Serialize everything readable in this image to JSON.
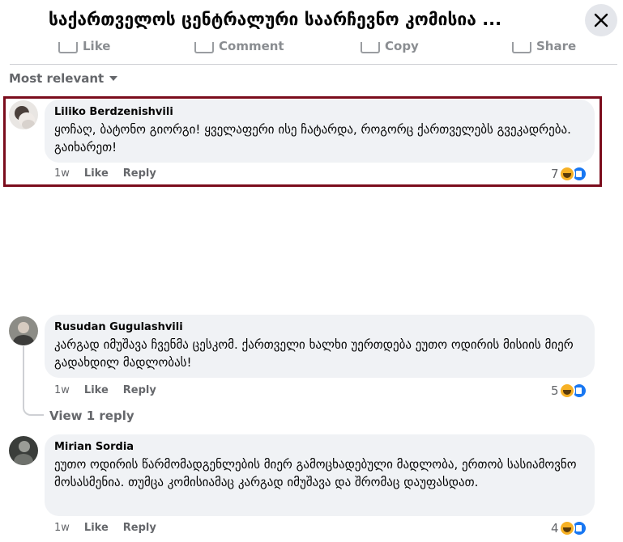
{
  "header": {
    "title": "საქართველოს ცენტრალური საარჩევნო კომისია ...",
    "close_icon": "close-icon"
  },
  "action_bar": [
    {
      "label": "Like",
      "icon": "thumbs-up-icon"
    },
    {
      "label": "Comment",
      "icon": "comment-icon"
    },
    {
      "label": "Copy",
      "icon": "copy-icon"
    },
    {
      "label": "Share",
      "icon": "share-icon"
    }
  ],
  "sort": {
    "label": "Most relevant",
    "icon": "caret-down-icon"
  },
  "comments": [
    {
      "author": "Liliko Berdzenishvili",
      "text": "ყოჩაღ, ბატონო გიორგი! ყველაფერი ისე ჩატარდა, როგორც ქართველებს გვეკადრება. გაიხარეთ!",
      "time": "1w",
      "like": "Like",
      "reply": "Reply",
      "reactions": "7"
    },
    {
      "author": "Rusudan Gugulashvili",
      "text": "კარგად იმუშავა ჩვენმა ცესკომ. ქართველი ხალხი უერთდება ეუთო ოდირის მისიის მიერ გადახდილ მადლობას!",
      "time": "1w",
      "like": "Like",
      "reply": "Reply",
      "reactions": "5",
      "view_replies": "View 1 reply"
    },
    {
      "author": "Mirian Sordia",
      "text": "ეუთო ოდირის წარმომადგენლების მიერ გამოცხადებული მადლობა, ერთობ სასიამოვნო მოსასმენია. თუმცა კომისიამაც კარგად იმუშავა და შრომაც დაუფასდათ.",
      "time": "1w",
      "like": "Like",
      "reply": "Reply",
      "reactions": "4"
    }
  ],
  "colors": {
    "highlight": "#7b0c1c",
    "bubble": "#f0f2f5",
    "like_blue": "#1877f2",
    "haha_yellow": "#f7b125"
  }
}
